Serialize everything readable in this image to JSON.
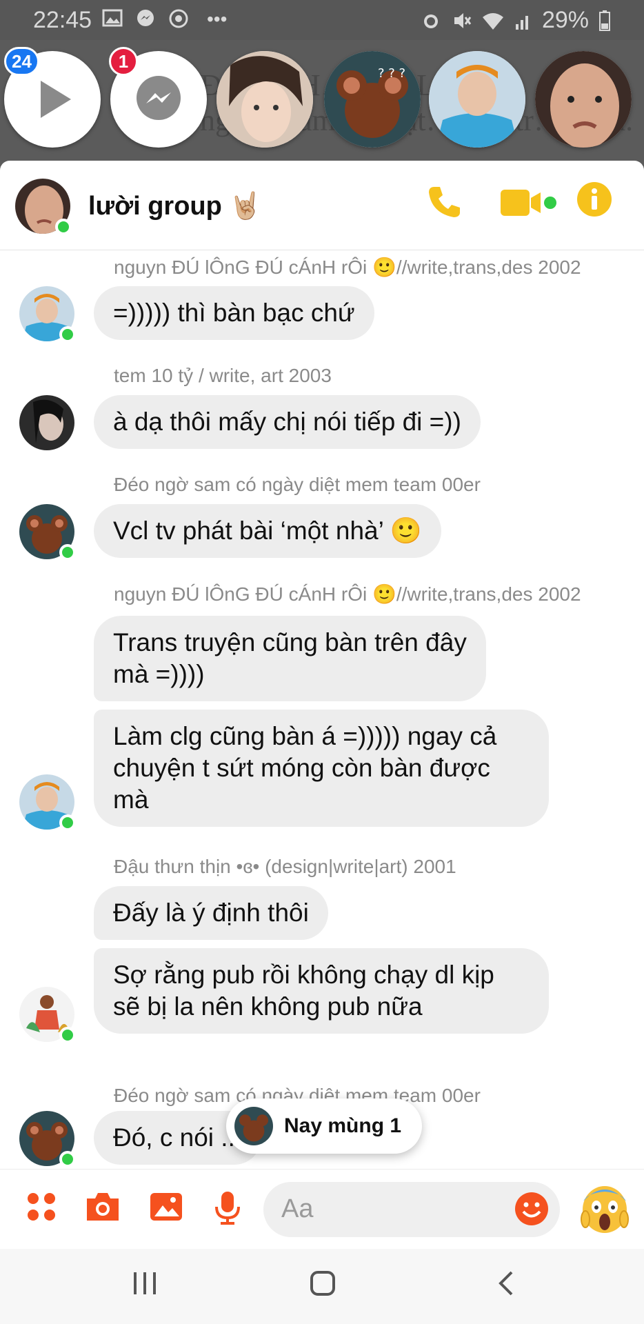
{
  "status_bar": {
    "time": "22:45",
    "battery": "29%",
    "left_icons": [
      "gallery-icon",
      "messenger-icon",
      "chrome-icon",
      "more-dots-icon"
    ],
    "right_icons": [
      "alarm-icon",
      "mute-icon",
      "wifi-icon",
      "signal-icon",
      "battery-icon"
    ]
  },
  "chat_heads": {
    "background_text": "ĐÊ… CH… …A L…D\nng… …ảm… …ạt… …a tr… …ín.",
    "items": [
      {
        "name": "video-head",
        "badge": "24",
        "badge_color": "#1877f2"
      },
      {
        "name": "messenger-head",
        "badge": "1",
        "badge_color": "#e41e3f"
      },
      {
        "name": "head-boy"
      },
      {
        "name": "head-jerry"
      },
      {
        "name": "head-girl-blue"
      },
      {
        "name": "head-girl-close"
      }
    ]
  },
  "chat": {
    "title": "lười group 🤘🏼",
    "accent_color": "#f6c21c",
    "messages": [
      {
        "sender": "nguyn ĐÚ lÔnG ĐÚ cÁnH rÔi 🙂//write,trans,des 2002",
        "bubbles": [
          "=))))) thì bàn bạc chứ"
        ],
        "avatar": "girl-blue"
      },
      {
        "sender": "tem 10 tỷ / write, art 2003",
        "bubbles": [
          "à dạ thôi mấy chị nói tiếp đi =))"
        ],
        "avatar": "girl-dark"
      },
      {
        "sender": "Đéo ngờ sam có ngày diệt mem team 00er",
        "bubbles": [
          "Vcl tv phát bài ‘một nhà’ 🙂"
        ],
        "avatar": "jerry"
      },
      {
        "sender": "nguyn ĐÚ lÔnG ĐÚ cÁnH rÔi 🙂//write,trans,des 2002",
        "bubbles": [
          "Trans truyện cũng bàn trên đây\nmà =))))",
          "Làm clg cũng bàn á =))))) ngay cả\nchuyện t sứt móng còn bàn được\nmà"
        ],
        "avatar": "girl-blue"
      },
      {
        "sender": "Đậu thưn thịn •ɞ•  (design|write|art) 2001",
        "bubbles": [
          "Đấy là ý định thôi",
          "Sợ rằng pub rồi không chạy dl kịp\nsẽ bị la nên không pub nữa"
        ],
        "avatar": "cartoon-girl"
      },
      {
        "sender": "Đéo ngờ sam có ngày diệt mem team 00er",
        "bubbles": [
          "Đó, c nói ..."
        ],
        "avatar": "jerry"
      }
    ],
    "toast": "Nay mùng 1",
    "composer_placeholder": "Aa",
    "composer_color": "#f5511e"
  },
  "nav": {
    "icons": [
      "recent-apps-icon",
      "home-icon",
      "back-icon"
    ]
  }
}
